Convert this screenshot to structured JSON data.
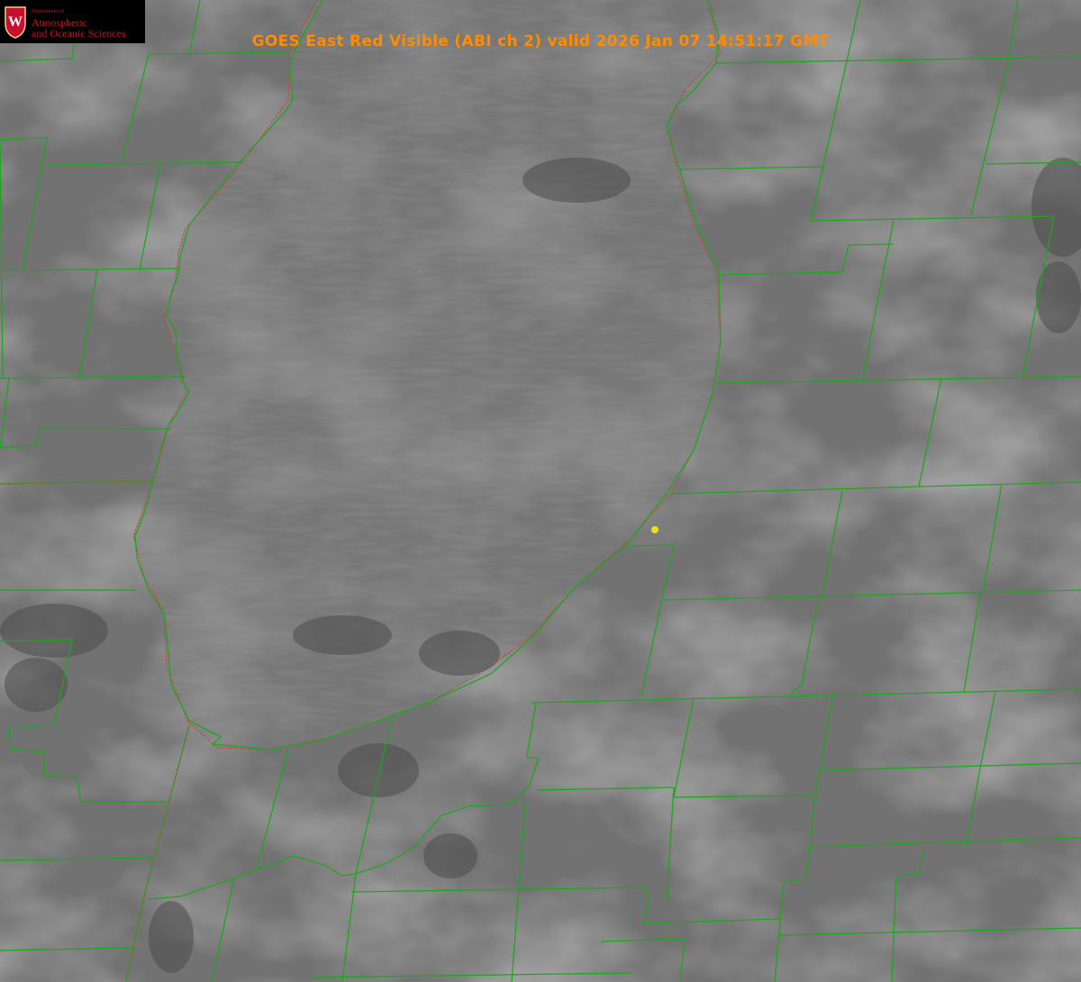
{
  "title": "GOES East Red Visible (ABI ch 2) valid 2026 Jan 07 14:51:17 GMT",
  "logo": {
    "department": "Department of",
    "line1": "Atmospheric",
    "line2": "and Oceanic Sciences",
    "crest_letter": "W"
  },
  "colors": {
    "title": "#ff8c00",
    "logo_text": "#c8102e",
    "boundaries": "#1fa51f",
    "coastline": "#e03030",
    "marker": "#e6e01e"
  },
  "icons": [
    "uw-crest-icon",
    "location-marker-icon"
  ]
}
